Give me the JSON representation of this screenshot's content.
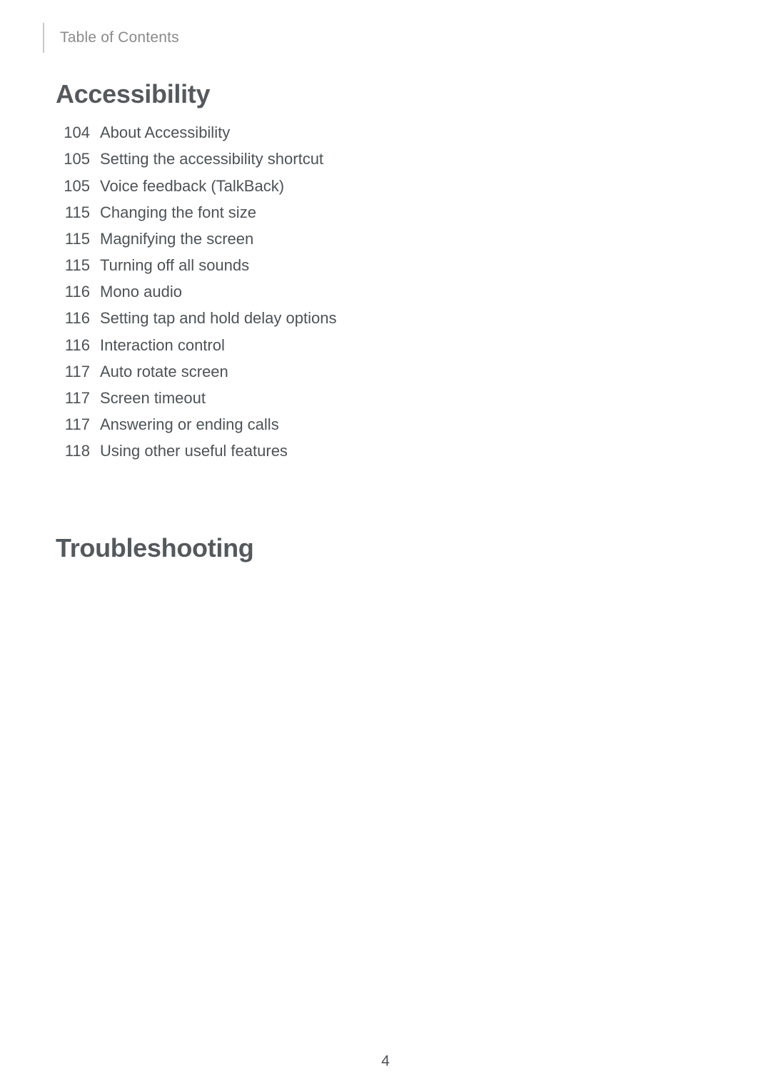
{
  "header": {
    "title": "Table of Contents"
  },
  "sections": [
    {
      "title": "Accessibility",
      "entries": [
        {
          "page": "104",
          "label": "About Accessibility"
        },
        {
          "page": "105",
          "label": "Setting the accessibility shortcut"
        },
        {
          "page": "105",
          "label": "Voice feedback (TalkBack)"
        },
        {
          "page": "115",
          "label": "Changing the font size"
        },
        {
          "page": "115",
          "label": "Magnifying the screen"
        },
        {
          "page": "115",
          "label": "Turning off all sounds"
        },
        {
          "page": "116",
          "label": "Mono audio"
        },
        {
          "page": "116",
          "label": "Setting tap and hold delay options"
        },
        {
          "page": "116",
          "label": "Interaction control"
        },
        {
          "page": "117",
          "label": "Auto rotate screen"
        },
        {
          "page": "117",
          "label": "Screen timeout"
        },
        {
          "page": "117",
          "label": "Answering or ending calls"
        },
        {
          "page": "118",
          "label": "Using other useful features"
        }
      ]
    },
    {
      "title": "Troubleshooting",
      "entries": []
    }
  ],
  "footer": {
    "page_number": "4"
  }
}
